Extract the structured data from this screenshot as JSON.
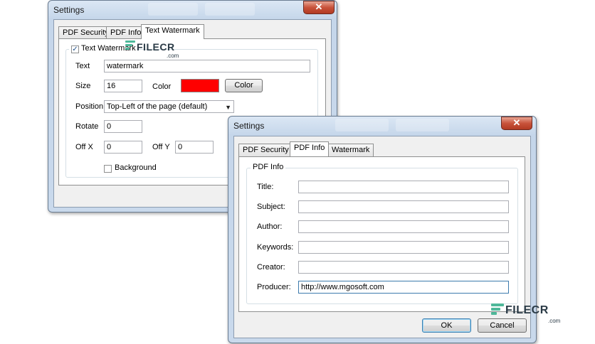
{
  "window1": {
    "title": "Settings",
    "close_glyph": "✕",
    "tabs": [
      "PDF Security",
      "PDF Info",
      "Text Watermark"
    ],
    "active_tab": "Text Watermark",
    "checkbox_label": "Text Watermark",
    "checkbox_checked": true,
    "checkbox_glyph": "✓",
    "text_label": "Text",
    "text_value": "watermark",
    "size_label": "Size",
    "size_value": "16",
    "color_label": "Color",
    "color_value": "#ff0000",
    "color_button": "Color",
    "position_label": "Position",
    "position_value": "Top-Left of the page (default)",
    "dropdown_glyph": "▼",
    "rotate_label": "Rotate",
    "rotate_value": "0",
    "offx_label": "Off X",
    "offx_value": "0",
    "offy_label": "Off Y",
    "offy_value": "0",
    "background_label": "Background",
    "background_checked": false
  },
  "window2": {
    "title": "Settings",
    "close_glyph": "✕",
    "tabs": [
      "PDF Security",
      "PDF Info",
      "Watermark"
    ],
    "active_tab": "PDF Info",
    "group_title": "PDF Info",
    "fields": [
      {
        "label": "Title:",
        "value": ""
      },
      {
        "label": "Subject:",
        "value": ""
      },
      {
        "label": "Author:",
        "value": ""
      },
      {
        "label": "Keywords:",
        "value": ""
      },
      {
        "label": "Creator:",
        "value": ""
      },
      {
        "label": "Producer:",
        "value": "http://www.mgosoft.com"
      }
    ],
    "ok_button": "OK",
    "cancel_button": "Cancel"
  },
  "watermark_logo": {
    "text": "FILECR",
    "suffix": ".com"
  },
  "colors": {
    "accent": "#4fb89a",
    "close": "#c8533b"
  }
}
